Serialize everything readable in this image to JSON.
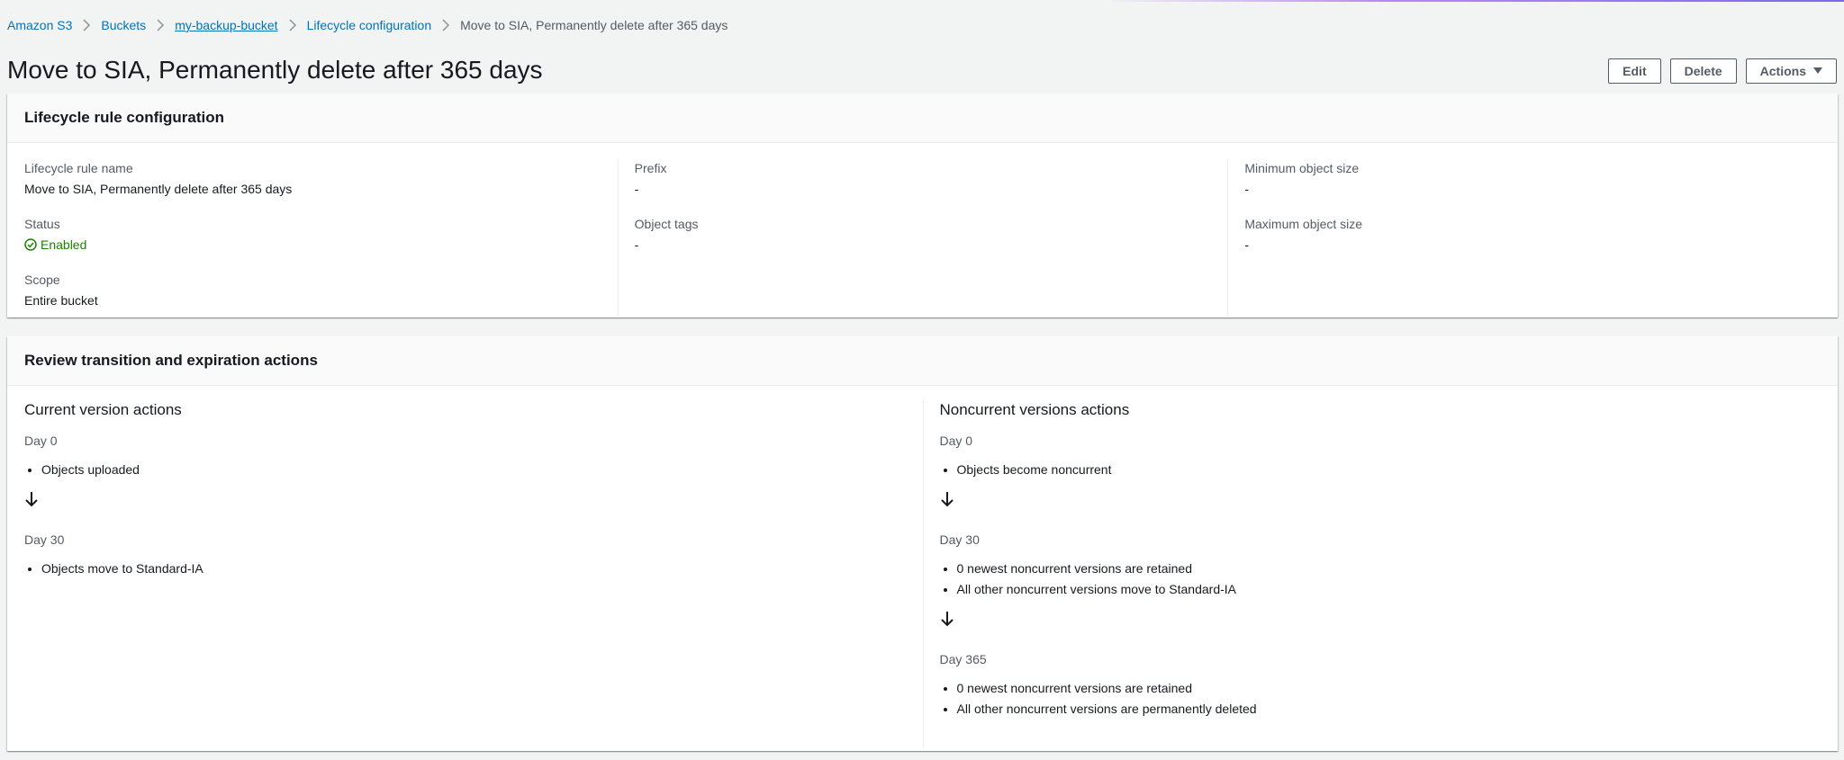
{
  "breadcrumb": [
    {
      "label": "Amazon S3"
    },
    {
      "label": "Buckets"
    },
    {
      "label": "my-backup-bucket"
    },
    {
      "label": "Lifecycle configuration"
    },
    {
      "label": "Move to SIA, Permanently delete after 365 days"
    }
  ],
  "header": {
    "title": "Move to SIA, Permanently delete after 365 days",
    "edit_label": "Edit",
    "delete_label": "Delete",
    "actions_label": "Actions"
  },
  "config": {
    "title": "Lifecycle rule configuration",
    "rule_name_key": "Lifecycle rule name",
    "rule_name_val": "Move to SIA, Permanently delete after 365 days",
    "status_key": "Status",
    "status_val": "Enabled",
    "scope_key": "Scope",
    "scope_val": "Entire bucket",
    "prefix_key": "Prefix",
    "prefix_val": "-",
    "tags_key": "Object tags",
    "tags_val": "-",
    "min_size_key": "Minimum object size",
    "min_size_val": "-",
    "max_size_key": "Maximum object size",
    "max_size_val": "-"
  },
  "review": {
    "title": "Review transition and expiration actions",
    "current": {
      "heading": "Current version actions",
      "day0": "Day 0",
      "day0_items": [
        "Objects uploaded"
      ],
      "day30": "Day 30",
      "day30_items": [
        "Objects move to Standard-IA"
      ]
    },
    "noncurrent": {
      "heading": "Noncurrent versions actions",
      "day0": "Day 0",
      "day0_items": [
        "Objects become noncurrent"
      ],
      "day30": "Day 30",
      "day30_items": [
        "0 newest noncurrent versions are retained",
        "All other noncurrent versions move to Standard-IA"
      ],
      "day365": "Day 365",
      "day365_items": [
        "0 newest noncurrent versions are retained",
        "All other noncurrent versions are permanently deleted"
      ]
    }
  },
  "colors": {
    "link": "#0073bb",
    "success": "#1d8102",
    "text": "#16191f",
    "muted": "#545b64"
  }
}
